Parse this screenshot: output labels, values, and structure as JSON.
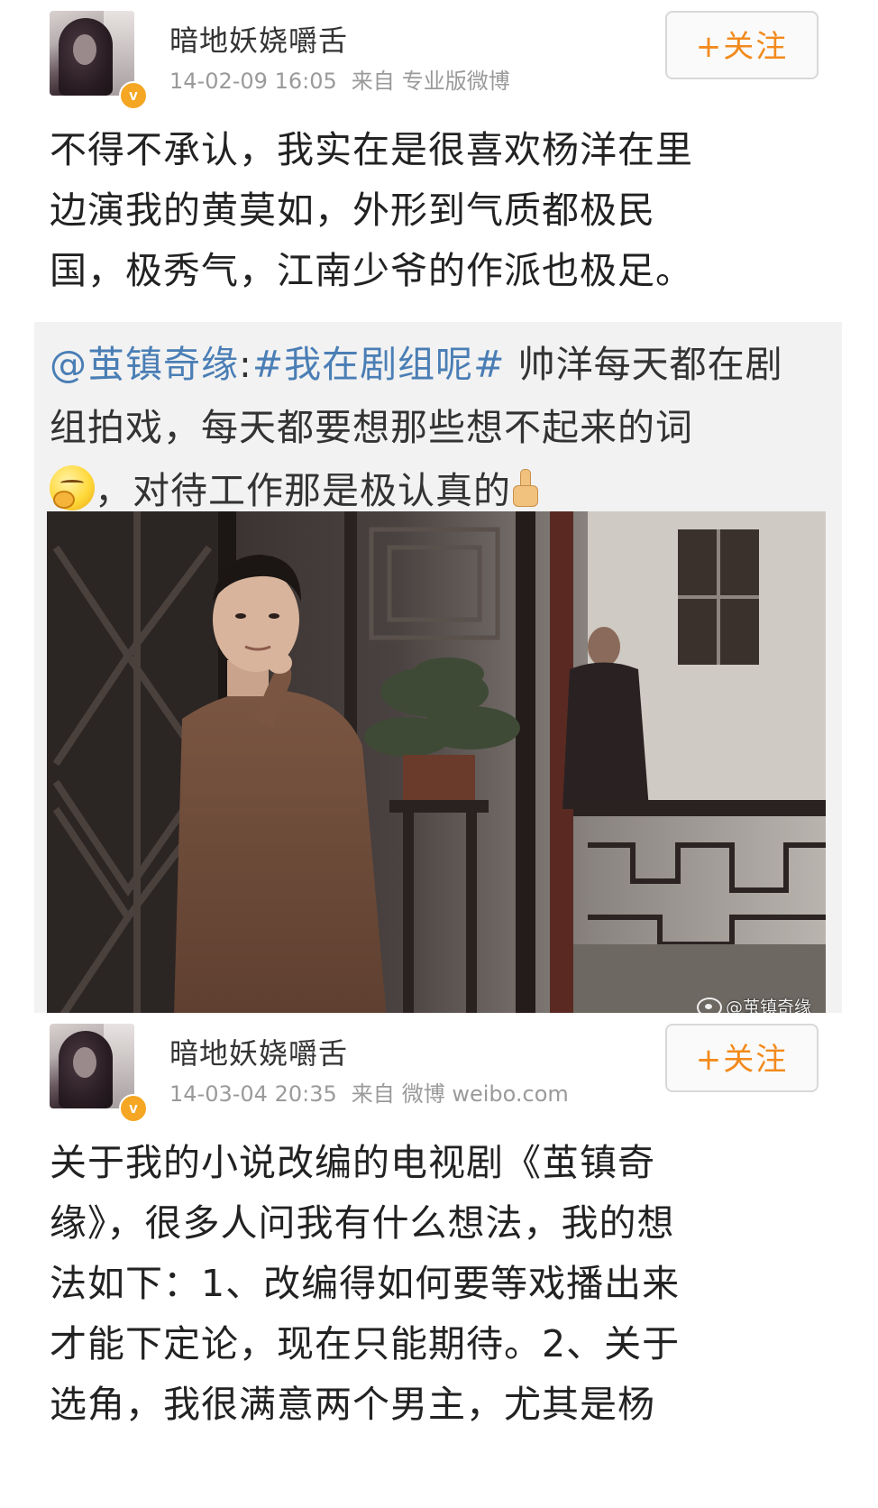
{
  "posts": [
    {
      "username": "暗地妖娆嚼舌",
      "timestamp": "14-02-09 16:05",
      "source_label": "来自",
      "source_name": "专业版微博",
      "follow_label": "+关注",
      "verified_badge": "v",
      "text_lines": [
        "不得不承认，我实在是很喜欢杨洋在里",
        "边演我的黄莫如，外形到气质都极民",
        "国，极秀气，江南少爷的作派也极足。"
      ]
    },
    {
      "username": "暗地妖娆嚼舌",
      "timestamp": "14-03-04 20:35",
      "source_label": "来自",
      "source_name": "微博 weibo.com",
      "follow_label": "+关注",
      "verified_badge": "v",
      "text_lines": [
        "关于我的小说改编的电视剧《茧镇奇",
        "缘》，很多人问我有什么想法，我的想",
        "法如下：1、改编得如何要等戏播出来",
        "才能下定论，现在只能期待。2、关于",
        "选角，我很满意两个男主，尤其是杨"
      ]
    }
  ],
  "repost": {
    "mention": "@茧镇奇缘",
    "colon": ":",
    "topic": "#我在剧组呢#",
    "line1_rest": " 帅洋每天都在剧",
    "line2": "组拍戏，每天都要想那些想不起来的词",
    "line3": "，对待工作那是极认真的",
    "emoji_1": "thinking-emoji",
    "emoji_2": "thumbs-up-emoji",
    "link_color": "#4a7eb5",
    "photo_watermark": "@茧镇奇缘"
  },
  "colors": {
    "follow_text": "#f28a1c",
    "verified_badge": "#f5a623",
    "meta_text": "#9a9a9a",
    "repost_bg": "#f2f2f2"
  }
}
